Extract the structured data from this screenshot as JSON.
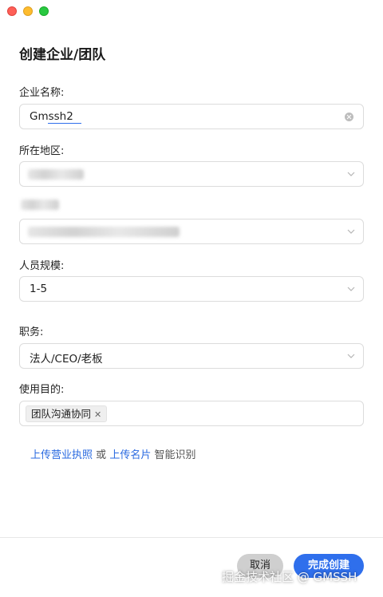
{
  "page_title": "创建企业/团队",
  "company_name": {
    "label": "企业名称:",
    "value": "Gmssh2"
  },
  "region": {
    "label": "所在地区:"
  },
  "team_size": {
    "label": "人员规模:",
    "value": "1-5"
  },
  "position": {
    "label": "职务:",
    "value": "法人/CEO/老板"
  },
  "purpose": {
    "label": "使用目的:",
    "tags": [
      "团队沟通协同"
    ]
  },
  "upload": {
    "license_link": "上传营业执照",
    "or": "或",
    "card_link": "上传名片",
    "suffix": "智能识别"
  },
  "footer": {
    "cancel_label": "取消",
    "create_label": "完成创建"
  },
  "watermark": "掘金技术社区 @ GMSSH",
  "colors": {
    "accent": "#2f6fec",
    "cancel_bg": "#cfcfcf"
  }
}
